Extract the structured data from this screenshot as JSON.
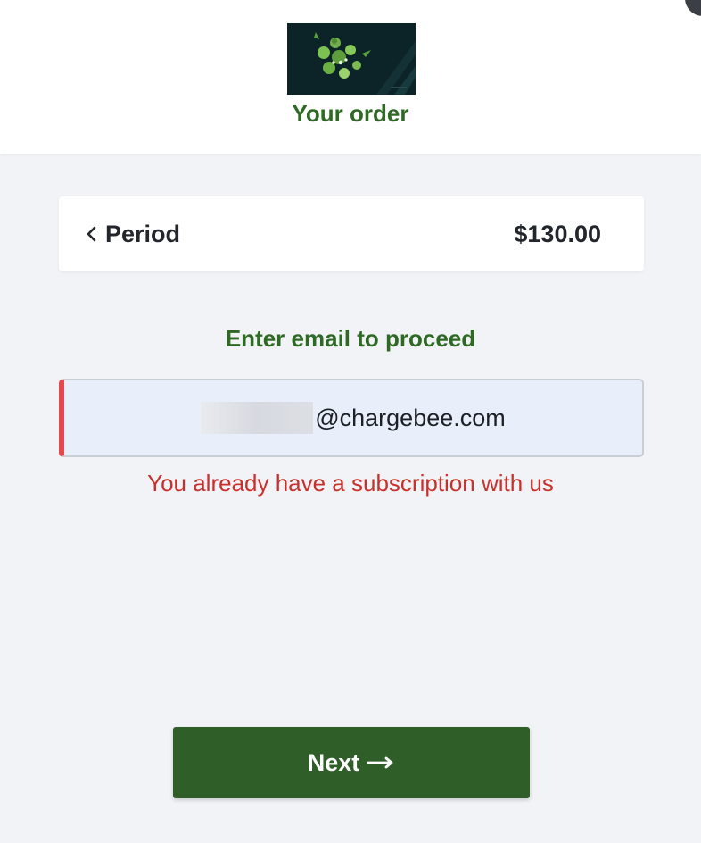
{
  "header": {
    "title": "Your order"
  },
  "period": {
    "label": "Period",
    "price": "$130.00"
  },
  "email": {
    "prompt": "Enter email to proceed",
    "value_visible_suffix": "@chargebee.com",
    "error": "You already have a subscription with us"
  },
  "footer": {
    "next_label": "Next"
  },
  "colors": {
    "brand_green": "#2f6a25",
    "button_green": "#2f5e29",
    "error_red": "#c9302c",
    "field_bg": "#e8eefa"
  }
}
